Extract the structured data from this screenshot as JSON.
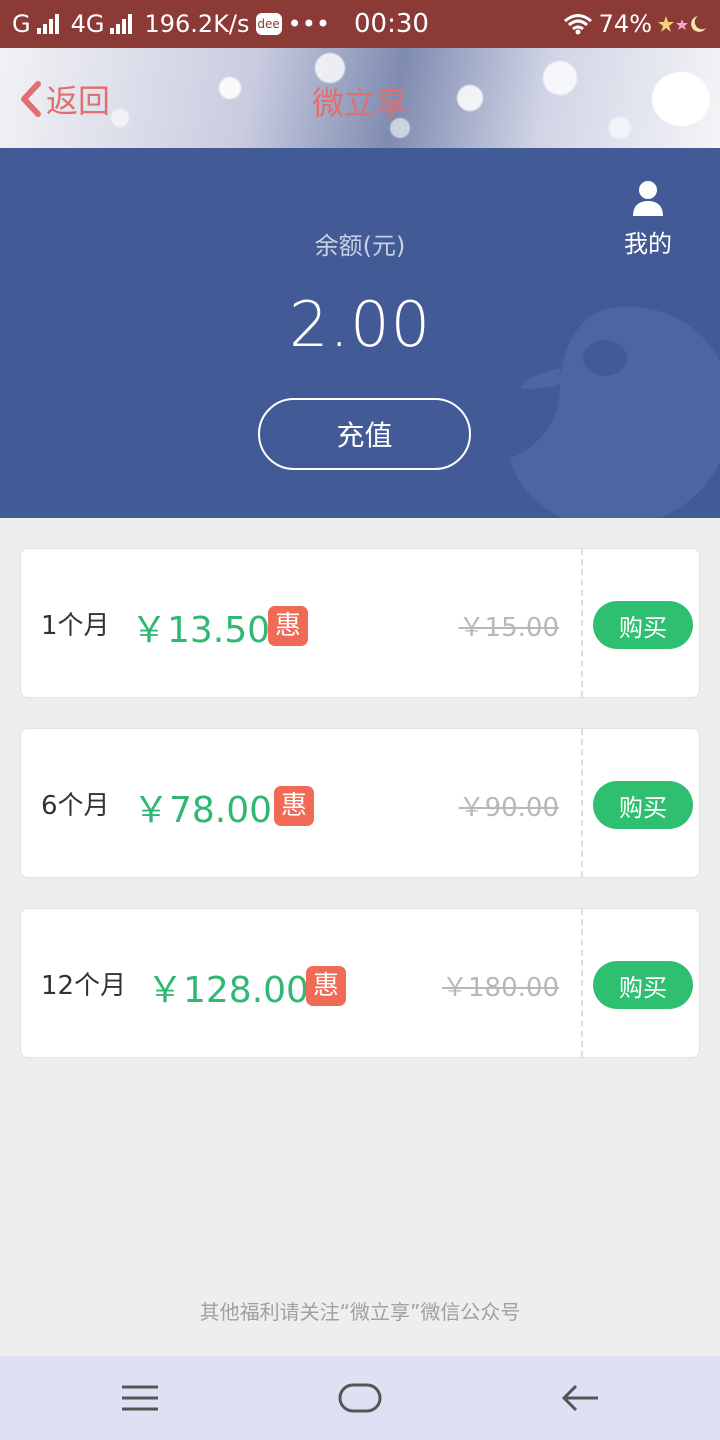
{
  "status_bar": {
    "carrier_left": "G",
    "network_type": "4G",
    "speed": "196.2K/s",
    "app_icon_text": "dee",
    "more": "•••",
    "time": "00:30",
    "battery": "74%"
  },
  "title_bar": {
    "back_label": "返回",
    "title": "微立享"
  },
  "balance": {
    "label": "余额(元)",
    "value": "2.00",
    "recharge_label": "充值",
    "profile_label": "我的"
  },
  "plans": [
    {
      "duration": "1个月",
      "price": "￥13.50",
      "badge": "惠",
      "original_price": "￥15.00",
      "buy_label": "购买"
    },
    {
      "duration": "6个月",
      "price": "￥78.00",
      "badge": "惠",
      "original_price": "￥90.00",
      "buy_label": "购买"
    },
    {
      "duration": "12个月",
      "price": "￥128.00",
      "badge": "惠",
      "original_price": "￥180.00",
      "buy_label": "购买"
    }
  ],
  "footer_note": "其他福利请关注“微立享”微信公众号",
  "nav_bar": {
    "icons": [
      "menu-icon",
      "home-icon",
      "back-arrow-icon"
    ]
  },
  "colors": {
    "status_bar_bg": "#8b3a36",
    "accent_red": "#e07070",
    "panel_blue": "#425a96",
    "price_green": "#2eb872",
    "buy_green": "#2fbf71",
    "badge_red": "#f06a55"
  }
}
